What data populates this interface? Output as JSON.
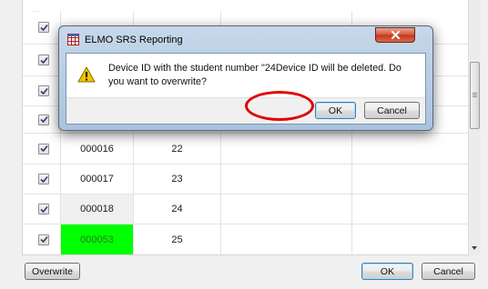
{
  "grid": {
    "rows": [
      {
        "id": "",
        "number": "",
        "checked": true,
        "style": "normal"
      },
      {
        "id": "",
        "number": "",
        "checked": true,
        "style": "normal"
      },
      {
        "id": "",
        "number": "",
        "checked": true,
        "style": "normal"
      },
      {
        "id": "",
        "number": "",
        "checked": true,
        "style": "normal"
      },
      {
        "id": "000016",
        "number": "22",
        "checked": true,
        "style": "normal"
      },
      {
        "id": "000017",
        "number": "23",
        "checked": true,
        "style": "normal"
      },
      {
        "id": "000018",
        "number": "24",
        "checked": true,
        "style": "gray"
      },
      {
        "id": "000053",
        "number": "25",
        "checked": true,
        "style": "green"
      }
    ]
  },
  "footer": {
    "overwrite_label": "Overwrite",
    "ok_label": "OK",
    "cancel_label": "Cancel"
  },
  "dialog": {
    "title": "ELMO SRS Reporting",
    "message": "Device ID with the student number \"24Device ID will be deleted. Do you want to overwrite?",
    "ok_label": "OK",
    "cancel_label": "Cancel"
  },
  "colors": {
    "highlight_green": "#00ff00",
    "annotation_red": "#e10000"
  },
  "icons": [
    "checkbox-check-icon",
    "app-grid-icon",
    "close-x-icon",
    "warning-icon"
  ]
}
